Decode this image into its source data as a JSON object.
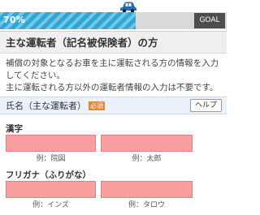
{
  "progress": {
    "percent_label": "70%",
    "fraction": 0.6,
    "goal_label": "GOAL",
    "bar_color": "#2ea6d6",
    "car_icon": "car-icon"
  },
  "section": {
    "title": "主な運転者（記名被保険者）の方",
    "description_1": "補償の対象となるお車を主に運転される方の情報を入力してください。",
    "description_2": "主に運転される方以外の運転者情報の入力は不要です。"
  },
  "field": {
    "label": "氏名（主な運転者）",
    "required_badge": "必須",
    "help_label": "ヘルプ"
  },
  "kanji": {
    "label": "漢字",
    "last_placeholder": "",
    "first_placeholder": "",
    "last_example": "例：院図",
    "first_example": "例：太郎"
  },
  "kana": {
    "label": "フリガナ（ふりがな）",
    "last_placeholder": "",
    "first_placeholder": "",
    "last_example": "例：インズ",
    "first_example": "例：タロウ"
  },
  "colors": {
    "input_bg": "#fa9f9f",
    "badge": "#e8832a",
    "goal_bg": "#4d4d4d"
  }
}
